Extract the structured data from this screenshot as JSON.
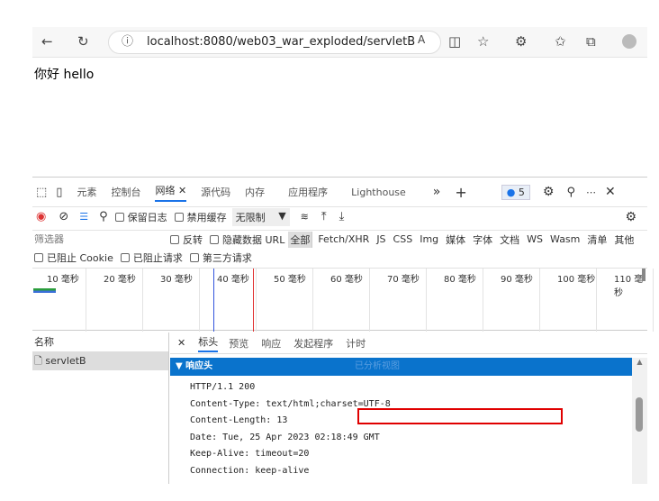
{
  "browser": {
    "url": "localhost:8080/web03_war_exploded/servletB",
    "icons": [
      "back-icon",
      "refresh-icon",
      "info-icon",
      "read-aloud-icon",
      "reader-view-icon",
      "favorite-add-icon",
      "extensions-icon",
      "favorites-icon",
      "collections-icon",
      "profile-icon"
    ]
  },
  "page": {
    "text": "你好 hello"
  },
  "devtools": {
    "tabs": [
      "元素",
      "控制台",
      "网络",
      "源代码",
      "内存",
      "应用程序",
      "Lighthouse"
    ],
    "active_tab": "网络",
    "issues_count": "5",
    "toolbar": {
      "preserve_log": "保留日志",
      "disable_cache": "禁用缓存",
      "throttle": "无限制"
    },
    "filter": {
      "placeholder": "筛选器",
      "invert": "反转",
      "hide_data_url": "隐藏数据 URL",
      "types": [
        "全部",
        "Fetch/XHR",
        "JS",
        "CSS",
        "Img",
        "媒体",
        "字体",
        "文档",
        "WS",
        "Wasm",
        "清单",
        "其他"
      ],
      "active_type": "全部"
    },
    "blocked": {
      "cookies": "已阻止 Cookie",
      "requests": "已阻止请求",
      "third_party": "第三方请求"
    },
    "timeline": {
      "ticks": [
        "10 毫秒",
        "20 毫秒",
        "30 毫秒",
        "40 毫秒",
        "50 毫秒",
        "60 毫秒",
        "70 毫秒",
        "80 毫秒",
        "90 毫秒",
        "100 毫秒",
        "110 毫秒"
      ]
    },
    "requests": {
      "header": "名称",
      "items": [
        "servletB"
      ]
    },
    "detail": {
      "tabs": [
        "标头",
        "预览",
        "响应",
        "发起程序",
        "计时"
      ],
      "active": "标头",
      "section": "▼ 响应头",
      "section_hint": "已分析视图",
      "headers": [
        "HTTP/1.1 200",
        "Content-Type: text/html;charset=UTF-8",
        "Content-Length: 13",
        "Date: Tue, 25 Apr 2023 02:18:49 GMT",
        "Keep-Alive: timeout=20",
        "Connection: keep-alive"
      ],
      "highlighted_index": 1
    },
    "colors": {
      "accent": "#1a73e8",
      "section_bg": "#0a73cc",
      "highlight_box": "#e00000"
    }
  }
}
